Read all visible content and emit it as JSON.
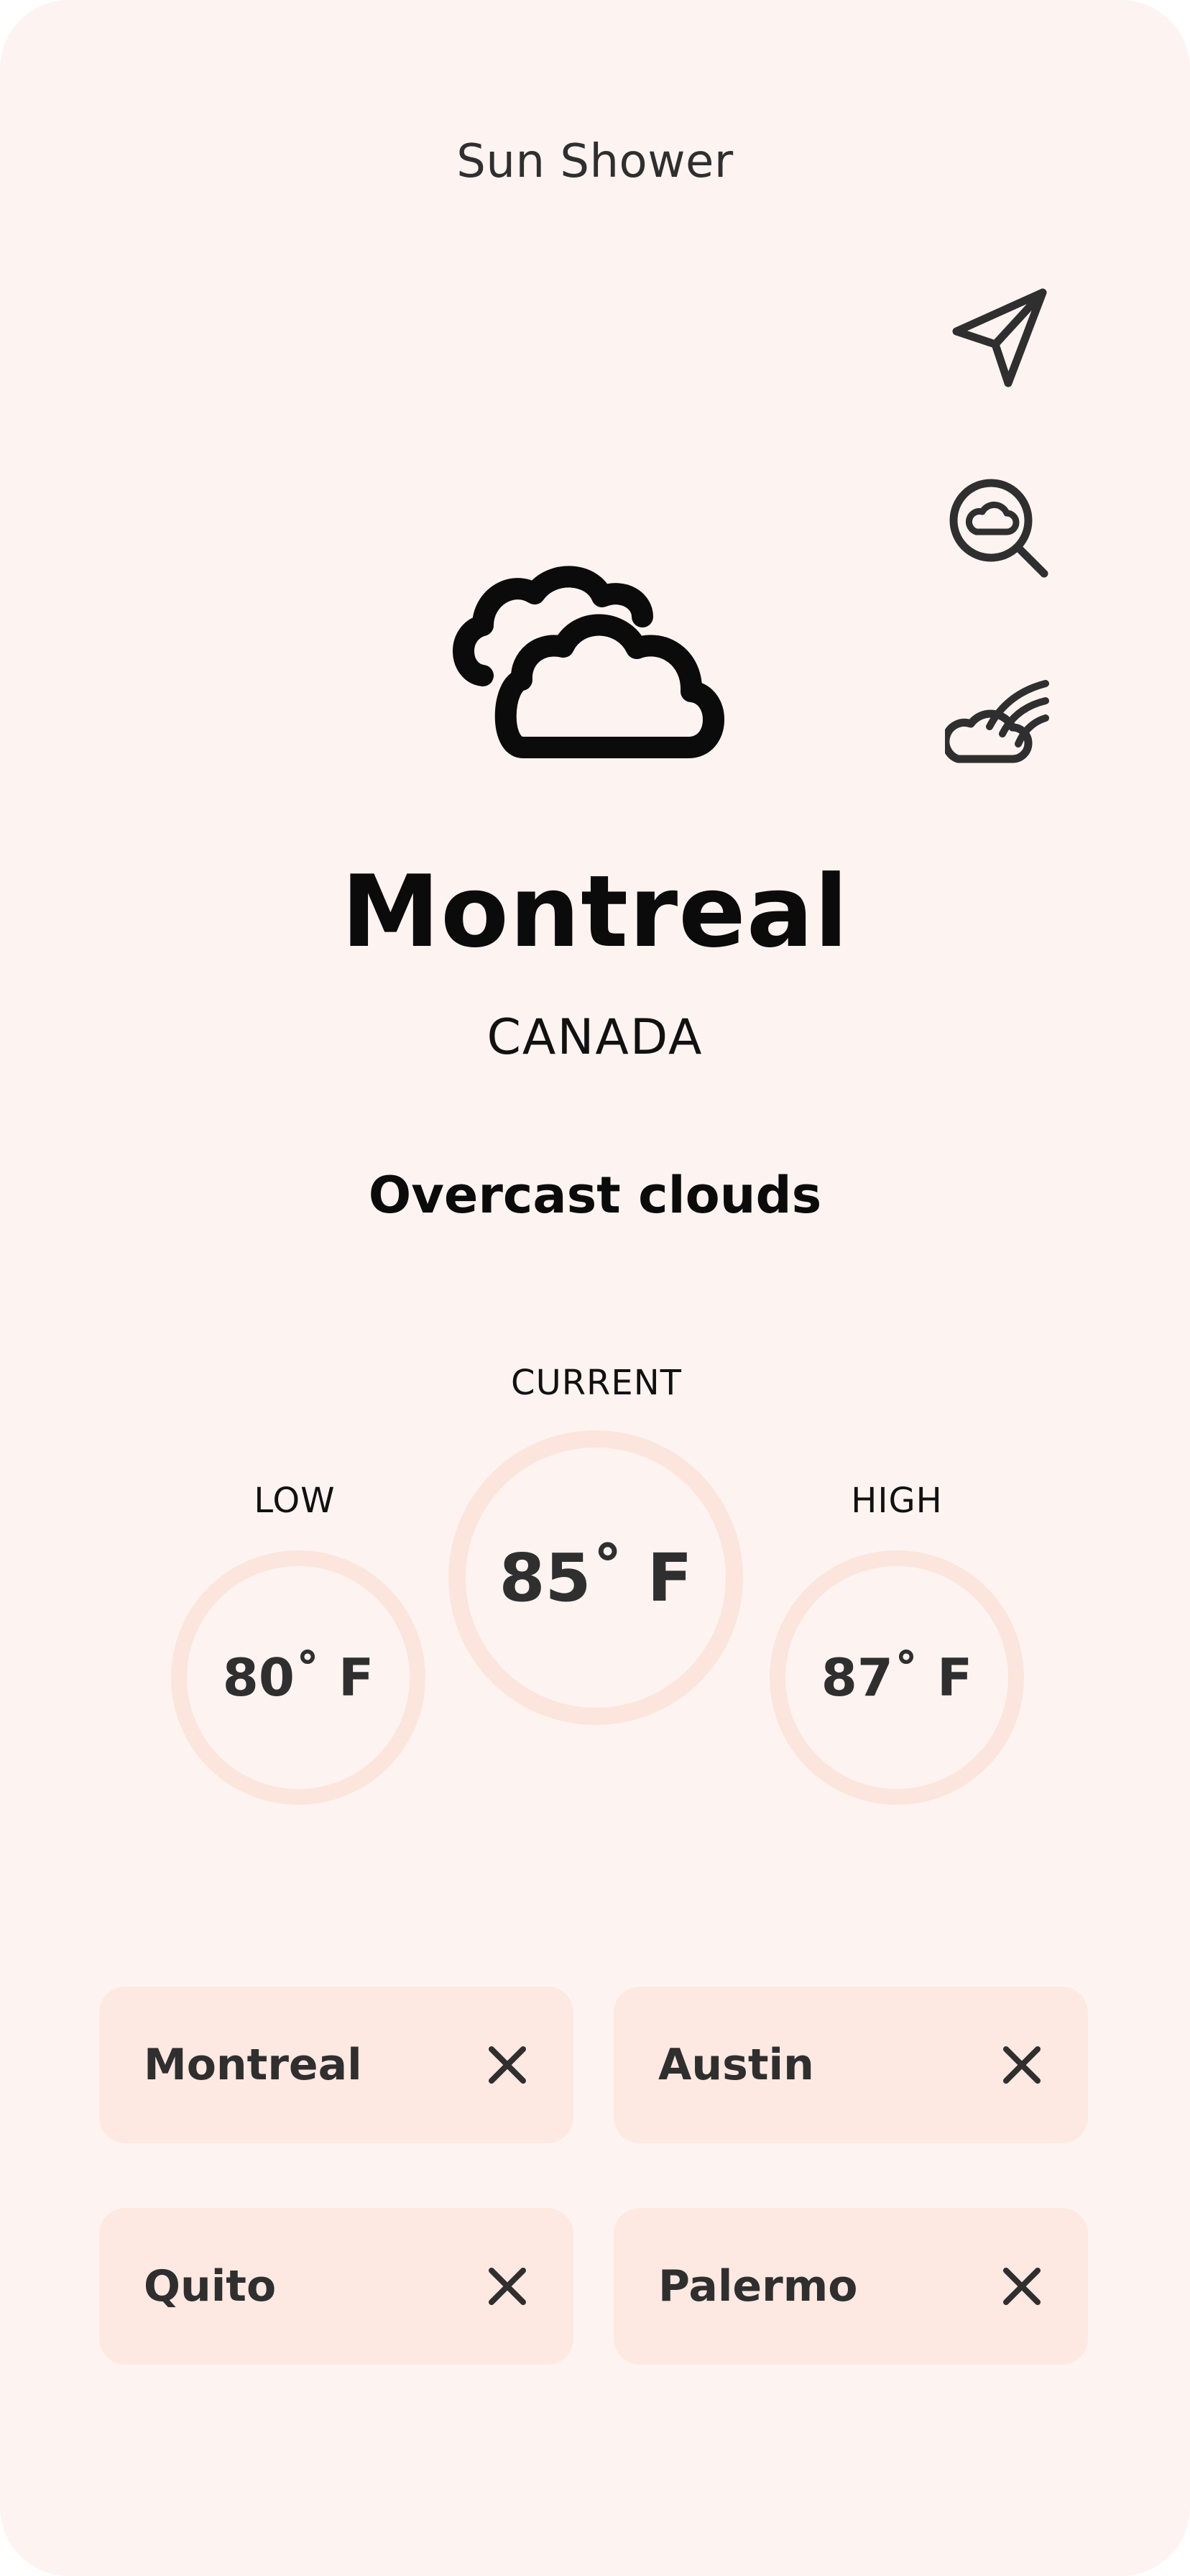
{
  "app": {
    "title": "Sun Shower"
  },
  "side_actions": [
    {
      "icon": "navigation-arrow-icon",
      "action": "current-location"
    },
    {
      "icon": "search-weather-icon",
      "action": "search"
    },
    {
      "icon": "weather-forecast-icon",
      "action": "forecast"
    }
  ],
  "weather": {
    "icon": "overcast-clouds-icon",
    "city": "Montreal",
    "country": "CANADA",
    "condition": "Overcast clouds"
  },
  "temperatures": {
    "low": {
      "label": "LOW",
      "value": "80˚ F"
    },
    "current": {
      "label": "CURRENT",
      "value": "85˚ F"
    },
    "high": {
      "label": "HIGH",
      "value": "87˚ F"
    }
  },
  "saved_cities": [
    {
      "name": "Montreal",
      "remove_icon": "close-icon"
    },
    {
      "name": "Austin",
      "remove_icon": "close-icon"
    },
    {
      "name": "Quito",
      "remove_icon": "close-icon"
    },
    {
      "name": "Palermo",
      "remove_icon": "close-icon"
    }
  ],
  "colors": {
    "background": "#fdf4f1",
    "ring": "#fbe5dc",
    "chip": "#fde9e1",
    "text_dark": "#2f2f2f",
    "text_black": "#0b0b0b"
  }
}
